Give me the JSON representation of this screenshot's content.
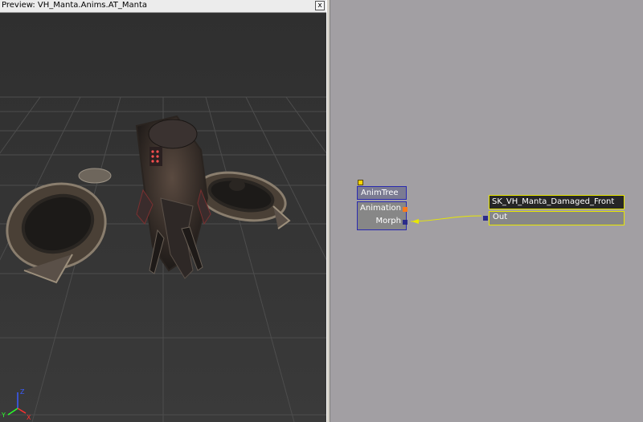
{
  "preview": {
    "title": "Preview: VH_Manta.Anims.AT_Manta",
    "close_label": "x"
  },
  "axis": {
    "x_label": "X",
    "y_label": "Y",
    "z_label": "Z"
  },
  "graph": {
    "animtree_node": {
      "title": "AnimTree",
      "inputs": [
        "Animation",
        "Morph"
      ]
    },
    "sequence_node": {
      "title": "SK_VH_Manta_Damaged_Front",
      "output": "Out"
    }
  },
  "colors": {
    "graph_bg": "#a29fa3",
    "viewport_bg": "#333333",
    "selected_outline": "#e8e800",
    "node_outline": "#2a2ab0",
    "animation_connector": "#ff7a1a",
    "morph_connector": "#2b2b8a",
    "link_wire": "#e8e800"
  }
}
